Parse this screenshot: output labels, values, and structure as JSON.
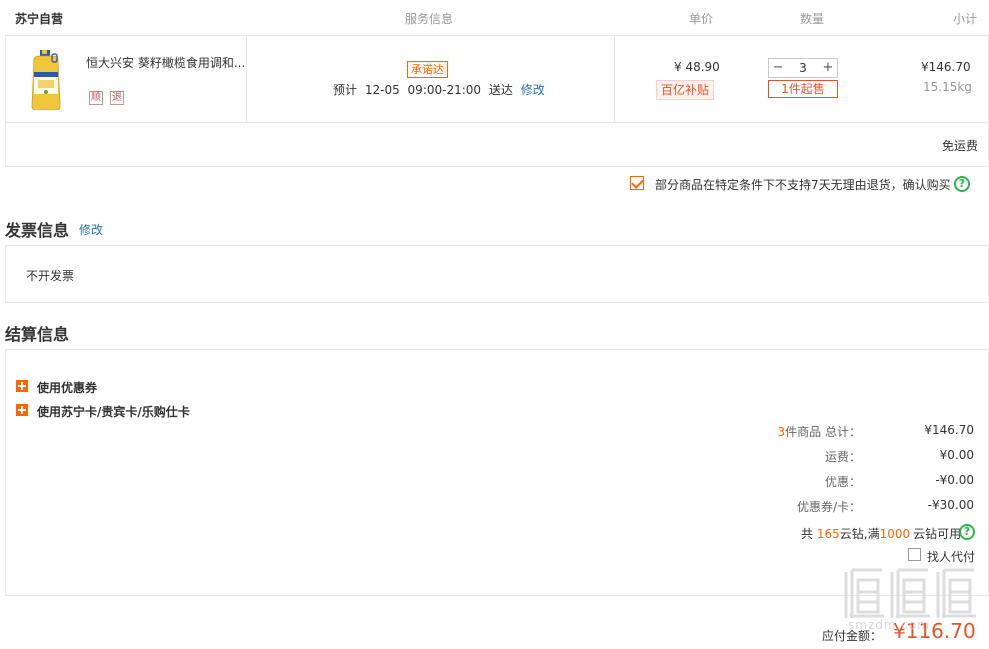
{
  "header": {
    "shop_name": "苏宁自营",
    "col_service": "服务信息",
    "col_price": "单价",
    "col_qty": "数量",
    "col_subtotal": "小计"
  },
  "product": {
    "name": "恒大兴安 葵籽橄榄食用调和...",
    "tag1": "顺",
    "tag2": "退",
    "promise_badge": "承诺达",
    "eta_prefix": "预计",
    "eta_date": "12-05",
    "eta_time": "09:00-21:00",
    "eta_suffix": "送达",
    "eta_edit": "修改",
    "price": "¥ 48.90",
    "subsidy_badge": "百亿补贴",
    "qty_minus": "−",
    "qty_value": "3",
    "qty_plus": "+",
    "min_qty": "1件起售",
    "subtotal": "¥146.70",
    "weight": "15.15kg"
  },
  "shipping": {
    "label": "免运费"
  },
  "confirm": {
    "text": "部分商品在特定条件下不支持7天无理由退货，确认购买",
    "help": "?"
  },
  "invoice": {
    "title": "发票信息",
    "edit": "修改",
    "value": "不开发票"
  },
  "settlement": {
    "title": "结算信息",
    "option1": "使用优惠券",
    "option2": "使用苏宁卡/贵宾卡/乐购仕卡",
    "items_count": "3",
    "items_label": "件商品 总计：",
    "items_total": "¥146.70",
    "freight_label": "运费：",
    "freight": "¥0.00",
    "discount_label": "优惠：",
    "discount": "-¥0.00",
    "coupon_label": "优惠券/卡：",
    "coupon": "-¥30.00",
    "diamond_prefix": "共",
    "diamond_count": "165",
    "diamond_mid": "云钻,满",
    "diamond_min": "1000",
    "diamond_suffix": "云钻可用",
    "help": "?",
    "proxy_pay": "找人代付",
    "pay_label": "应付金额：",
    "pay_total": "¥116.70"
  },
  "watermark": {
    "text": "值",
    "sub": "smzdm.com"
  },
  "colors": {
    "accent": "#ff6600",
    "price_red": "#e5532b",
    "link": "#2a6fb8",
    "help_green": "#2db34a"
  }
}
